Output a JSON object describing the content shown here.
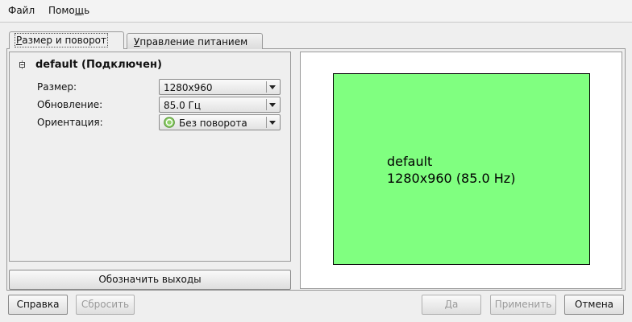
{
  "menu": {
    "file": "Файл",
    "help_prefix": "Помо",
    "help_underline": "щ",
    "help_suffix": "ь"
  },
  "tabs": [
    {
      "label_underline": "Р",
      "label_rest": "азмер и поворот"
    },
    {
      "label_underline": "У",
      "label_rest": "правление питанием"
    }
  ],
  "output": {
    "name": "default (Подключен)",
    "size_label": "Размер:",
    "size_value": "1280x960",
    "refresh_label": "Обновление:",
    "refresh_value": "85.0 Гц",
    "orientation_label": "Ориентация:",
    "orientation_value": "Без поворота"
  },
  "identify_button": "Обозначить выходы",
  "preview": {
    "name": "default",
    "mode": "1280x960 (85.0 Hz)",
    "monitor_color": "#80ff80"
  },
  "buttons": {
    "help": "Справка",
    "reset": "Сбросить",
    "ok": "Да",
    "apply": "Применить",
    "cancel": "Отмена"
  }
}
